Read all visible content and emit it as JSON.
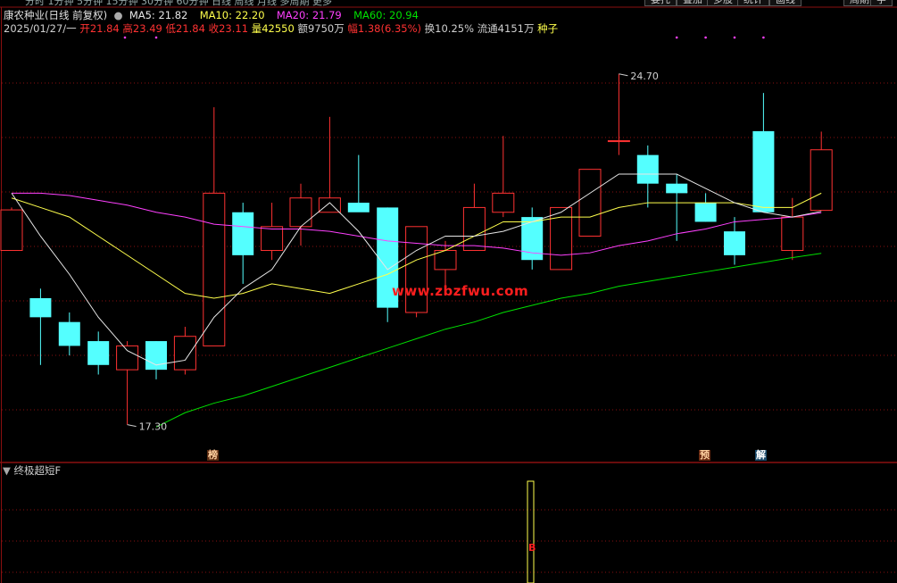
{
  "header": {
    "stock_name": "康农种业(日线 前复权)",
    "ma5": "MA5: 21.82",
    "ma10": "MA10: 22.20",
    "ma20": "MA20: 21.79",
    "ma60": "MA60: 20.94",
    "date": "2025/01/27/一",
    "open": "开21.84",
    "high": "高23.49",
    "low": "低21.84",
    "close": "收23.11",
    "volume": "量42550",
    "amount": "额9750万",
    "change": "幅1.38(6.35%)",
    "turnover": "换10.25%",
    "float": "流通4151万",
    "sector": "种子"
  },
  "colors": {
    "up": "#ff3232",
    "down": "#54ffff",
    "ma5": "#e6e6e6",
    "ma10": "#ffff4c",
    "ma20": "#ff40ff",
    "ma60": "#00e000",
    "grid": "#8a1010"
  },
  "annotations": {
    "high_label": "24.70",
    "low_label": "17.30",
    "tag_bang": "榜",
    "tag_yu": "预",
    "tag_jie": "解"
  },
  "watermark": "www.zbzfwu.com",
  "indicator": {
    "name": "终极超短F",
    "signal": "B"
  },
  "chart_data": {
    "type": "candlestick",
    "ylim": [
      16.8,
      25.5
    ],
    "candles": [
      {
        "o": 21.0,
        "h": 21.9,
        "l": 21.0,
        "c": 21.85
      },
      {
        "o": 20.0,
        "h": 20.2,
        "l": 18.6,
        "c": 19.6
      },
      {
        "o": 19.5,
        "h": 19.7,
        "l": 18.8,
        "c": 19.0
      },
      {
        "o": 19.1,
        "h": 19.3,
        "l": 18.4,
        "c": 18.6
      },
      {
        "o": 18.5,
        "h": 19.1,
        "l": 17.35,
        "c": 19.0
      },
      {
        "o": 19.1,
        "h": 19.1,
        "l": 18.3,
        "c": 18.5
      },
      {
        "o": 18.5,
        "h": 19.4,
        "l": 18.4,
        "c": 19.2
      },
      {
        "o": 19.0,
        "h": 24.0,
        "l": 19.0,
        "c": 22.2
      },
      {
        "o": 21.8,
        "h": 22.0,
        "l": 20.3,
        "c": 20.9
      },
      {
        "o": 21.0,
        "h": 22.0,
        "l": 20.8,
        "c": 21.5
      },
      {
        "o": 21.5,
        "h": 22.4,
        "l": 21.1,
        "c": 22.1
      },
      {
        "o": 21.8,
        "h": 23.8,
        "l": 21.8,
        "c": 22.1
      },
      {
        "o": 22.0,
        "h": 23.0,
        "l": 21.9,
        "c": 21.8
      },
      {
        "o": 21.9,
        "h": 21.9,
        "l": 19.5,
        "c": 19.8
      },
      {
        "o": 19.7,
        "h": 21.5,
        "l": 19.6,
        "c": 21.5
      },
      {
        "o": 20.6,
        "h": 21.2,
        "l": 20.1,
        "c": 21.0
      },
      {
        "o": 21.0,
        "h": 22.4,
        "l": 21.0,
        "c": 21.9
      },
      {
        "o": 21.8,
        "h": 23.4,
        "l": 21.7,
        "c": 22.2
      },
      {
        "o": 21.7,
        "h": 21.9,
        "l": 20.6,
        "c": 20.8
      },
      {
        "o": 20.6,
        "h": 21.9,
        "l": 20.6,
        "c": 21.9
      },
      {
        "o": 21.3,
        "h": 22.5,
        "l": 21.3,
        "c": 22.7
      },
      {
        "o": 23.3,
        "h": 24.7,
        "l": 23.0,
        "c": 23.3
      },
      {
        "o": 23.0,
        "h": 23.2,
        "l": 21.9,
        "c": 22.4
      },
      {
        "o": 22.4,
        "h": 22.6,
        "l": 21.2,
        "c": 22.2
      },
      {
        "o": 22.0,
        "h": 22.2,
        "l": 21.6,
        "c": 21.6
      },
      {
        "o": 21.4,
        "h": 21.7,
        "l": 20.7,
        "c": 20.9
      },
      {
        "o": 23.5,
        "h": 24.3,
        "l": 21.8,
        "c": 21.8
      },
      {
        "o": 21.0,
        "h": 22.1,
        "l": 20.8,
        "c": 21.7
      },
      {
        "o": 21.84,
        "h": 23.49,
        "l": 21.84,
        "c": 23.11
      }
    ],
    "ma5": [
      22.2,
      21.3,
      20.5,
      19.6,
      18.9,
      18.6,
      18.7,
      19.6,
      20.2,
      20.6,
      21.5,
      22.0,
      21.4,
      20.6,
      21.0,
      21.3,
      21.3,
      21.4,
      21.6,
      21.8,
      22.2,
      22.6,
      22.6,
      22.6,
      22.3,
      22.0,
      21.8,
      21.7,
      21.82
    ],
    "ma10": [
      22.1,
      21.9,
      21.7,
      21.3,
      20.9,
      20.5,
      20.1,
      20.0,
      20.1,
      20.3,
      20.2,
      20.1,
      20.3,
      20.5,
      20.8,
      21.0,
      21.3,
      21.6,
      21.6,
      21.7,
      21.7,
      21.9,
      22.0,
      22.0,
      22.0,
      22.0,
      21.9,
      21.9,
      22.2
    ],
    "ma20": [
      22.2,
      22.2,
      22.15,
      22.05,
      21.95,
      21.8,
      21.7,
      21.55,
      21.5,
      21.45,
      21.45,
      21.4,
      21.3,
      21.2,
      21.15,
      21.1,
      21.1,
      21.05,
      20.95,
      20.9,
      20.95,
      21.1,
      21.2,
      21.35,
      21.45,
      21.6,
      21.65,
      21.7,
      21.79
    ],
    "ma60": [
      null,
      null,
      null,
      null,
      null,
      17.3,
      17.6,
      17.8,
      17.95,
      18.15,
      18.35,
      18.55,
      18.75,
      18.95,
      19.15,
      19.35,
      19.5,
      19.7,
      19.85,
      20.0,
      20.1,
      20.25,
      20.35,
      20.45,
      20.55,
      20.65,
      20.75,
      20.85,
      20.94
    ]
  }
}
